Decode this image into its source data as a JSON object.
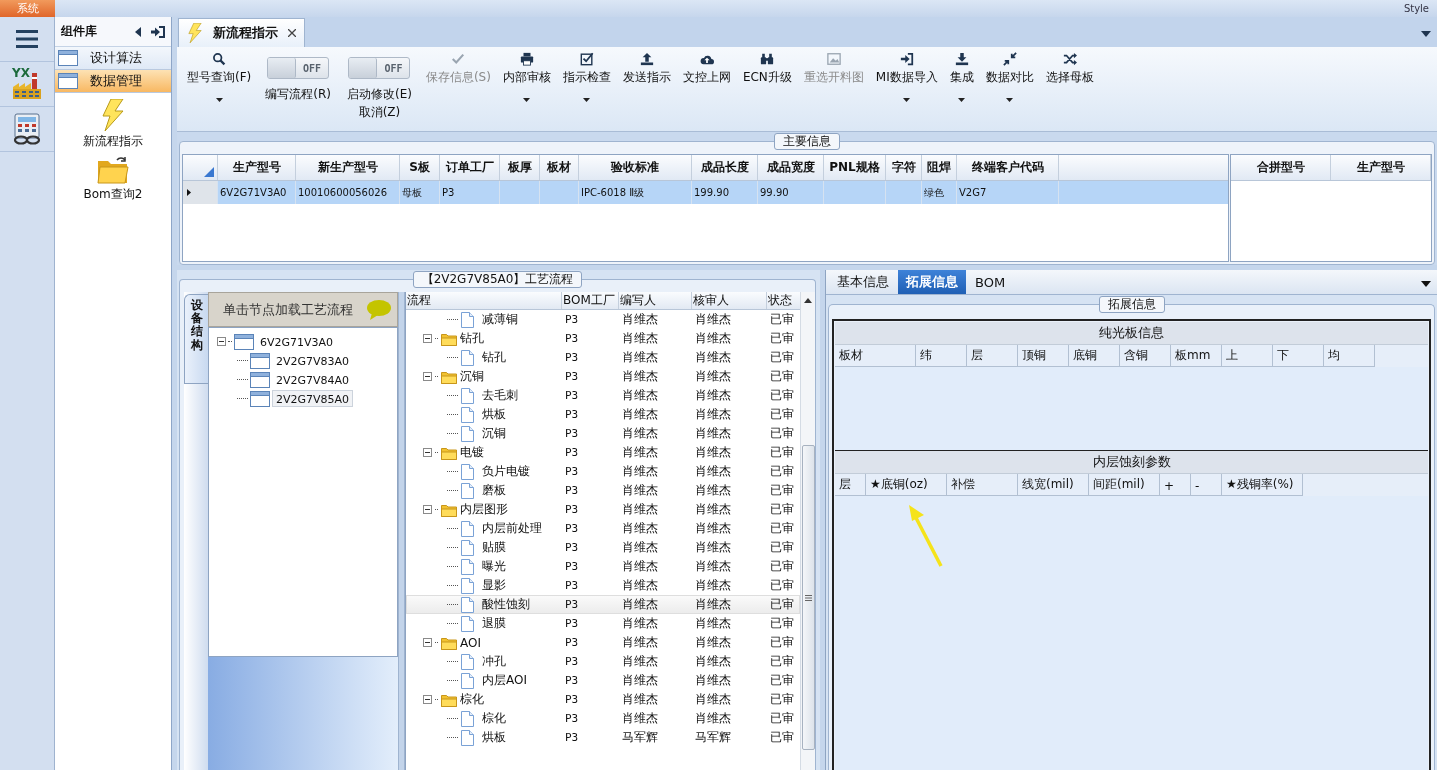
{
  "top_bar": {
    "system_button": "系统",
    "style_label": "Style"
  },
  "rail": {
    "app_badge": "YX"
  },
  "component_panel": {
    "title": "组件库",
    "groups": [
      {
        "label": "设计算法",
        "selected": false
      },
      {
        "label": "数据管理",
        "selected": true
      }
    ],
    "items": [
      {
        "label": "新流程指示"
      },
      {
        "label": "Bom查询2"
      }
    ]
  },
  "document_tab": {
    "label": "新流程指示"
  },
  "toolbar": [
    {
      "kind": "button",
      "label": "型号查询(F)",
      "dropdown": true,
      "disabled": false
    },
    {
      "kind": "toggle",
      "label": "编写流程(R)",
      "state_text": "OFF",
      "on": false
    },
    {
      "kind": "toggle",
      "label": "启动修改(E)\n取消(Z)",
      "state_text": "OFF",
      "on": false
    },
    {
      "kind": "button",
      "label": "保存信息(S)",
      "dropdown": false,
      "disabled": true
    },
    {
      "kind": "button",
      "label": "内部审核",
      "dropdown": true,
      "disabled": false
    },
    {
      "kind": "button",
      "label": "指示检查",
      "dropdown": true,
      "disabled": false
    },
    {
      "kind": "button",
      "label": "发送指示",
      "dropdown": false,
      "disabled": false
    },
    {
      "kind": "button",
      "label": "文控上网",
      "dropdown": false,
      "disabled": false
    },
    {
      "kind": "button",
      "label": "ECN升级",
      "dropdown": false,
      "disabled": false
    },
    {
      "kind": "button",
      "label": "重选开料图",
      "dropdown": false,
      "disabled": true
    },
    {
      "kind": "button",
      "label": "MI数据导入",
      "dropdown": true,
      "disabled": false
    },
    {
      "kind": "button",
      "label": "集成",
      "dropdown": true,
      "disabled": false
    },
    {
      "kind": "button",
      "label": "数据对比",
      "dropdown": true,
      "disabled": false
    },
    {
      "kind": "button",
      "label": "选择母板",
      "dropdown": false,
      "disabled": false
    }
  ],
  "main_info": {
    "title": "主要信息",
    "columns": [
      "生产型号",
      "新生产型号",
      "S板",
      "订单工厂",
      "板厚",
      "板材",
      "验收标准",
      "成品长度",
      "成品宽度",
      "PNL规格",
      "字符",
      "阻焊",
      "终端客户代码"
    ],
    "rows": [
      {
        "selected": true,
        "cells": [
          "6V2G71V3A0",
          "10010600056026",
          "母板",
          "P3",
          null,
          null,
          "IPC-6018 Ⅱ级",
          "199.90",
          "99.90",
          null,
          null,
          "绿色",
          "V2G7"
        ]
      }
    ],
    "side_columns": [
      "合拼型号",
      "生产型号"
    ]
  },
  "process_panel": {
    "title": "【2V2G7V85A0】工艺流程",
    "side_tab": "设备结构",
    "hint": "单击节点加载工艺流程",
    "tree": [
      {
        "label": "6V2G71V3A0",
        "expanded": true,
        "selected": false,
        "children": [
          {
            "label": "2V2G7V83A0",
            "selected": false
          },
          {
            "label": "2V2G7V84A0",
            "selected": false
          },
          {
            "label": "2V2G7V85A0",
            "selected": true
          }
        ]
      }
    ],
    "columns": [
      "流程",
      "BOM工厂",
      "编写人",
      "核审人",
      "状态"
    ],
    "rows": [
      {
        "kind": "continued",
        "children": [
          {
            "kind": "step",
            "label": "减薄铜",
            "factory": "P3",
            "writer": "肖维杰",
            "reviewer": "肖维杰",
            "status": "已审",
            "selected": false
          }
        ]
      },
      {
        "kind": "group",
        "label": "钻孔",
        "factory": "P3",
        "writer": "肖维杰",
        "reviewer": "肖维杰",
        "status": "已审",
        "selected": false,
        "expanded": true,
        "children": [
          {
            "kind": "step",
            "label": "钻孔",
            "factory": "P3",
            "writer": "肖维杰",
            "reviewer": "肖维杰",
            "status": "已审",
            "selected": false
          }
        ]
      },
      {
        "kind": "group",
        "label": "沉铜",
        "factory": "P3",
        "writer": "肖维杰",
        "reviewer": "肖维杰",
        "status": "已审",
        "selected": false,
        "expanded": true,
        "children": [
          {
            "kind": "step",
            "label": "去毛刺",
            "factory": "P3",
            "writer": "肖维杰",
            "reviewer": "肖维杰",
            "status": "已审",
            "selected": false
          },
          {
            "kind": "step",
            "label": "烘板",
            "factory": "P3",
            "writer": "肖维杰",
            "reviewer": "肖维杰",
            "status": "已审",
            "selected": false
          },
          {
            "kind": "step",
            "label": "沉铜",
            "factory": "P3",
            "writer": "肖维杰",
            "reviewer": "肖维杰",
            "status": "已审",
            "selected": false
          }
        ]
      },
      {
        "kind": "group",
        "label": "电镀",
        "factory": "P3",
        "writer": "肖维杰",
        "reviewer": "肖维杰",
        "status": "已审",
        "selected": false,
        "expanded": true,
        "children": [
          {
            "kind": "step",
            "label": "负片电镀",
            "factory": "P3",
            "writer": "肖维杰",
            "reviewer": "肖维杰",
            "status": "已审",
            "selected": false
          },
          {
            "kind": "step",
            "label": "磨板",
            "factory": "P3",
            "writer": "肖维杰",
            "reviewer": "肖维杰",
            "status": "已审",
            "selected": false
          }
        ]
      },
      {
        "kind": "group",
        "label": "内层图形",
        "factory": "P3",
        "writer": "肖维杰",
        "reviewer": "肖维杰",
        "status": "已审",
        "selected": false,
        "expanded": true,
        "children": [
          {
            "kind": "step",
            "label": "内层前处理",
            "factory": "P3",
            "writer": "肖维杰",
            "reviewer": "肖维杰",
            "status": "已审",
            "selected": false
          },
          {
            "kind": "step",
            "label": "贴膜",
            "factory": "P3",
            "writer": "肖维杰",
            "reviewer": "肖维杰",
            "status": "已审",
            "selected": false
          },
          {
            "kind": "step",
            "label": "曝光",
            "factory": "P3",
            "writer": "肖维杰",
            "reviewer": "肖维杰",
            "status": "已审",
            "selected": false
          },
          {
            "kind": "step",
            "label": "显影",
            "factory": "P3",
            "writer": "肖维杰",
            "reviewer": "肖维杰",
            "status": "已审",
            "selected": false
          },
          {
            "kind": "step",
            "label": "酸性蚀刻",
            "factory": "P3",
            "writer": "肖维杰",
            "reviewer": "肖维杰",
            "status": "已审",
            "selected": true
          },
          {
            "kind": "step",
            "label": "退膜",
            "factory": "P3",
            "writer": "肖维杰",
            "reviewer": "肖维杰",
            "status": "已审",
            "selected": false
          }
        ]
      },
      {
        "kind": "group",
        "label": "AOI",
        "factory": "P3",
        "writer": "肖维杰",
        "reviewer": "肖维杰",
        "status": "已审",
        "selected": false,
        "expanded": true,
        "children": [
          {
            "kind": "step",
            "label": "冲孔",
            "factory": "P3",
            "writer": "肖维杰",
            "reviewer": "肖维杰",
            "status": "已审",
            "selected": false
          },
          {
            "kind": "step",
            "label": "内层AOI",
            "factory": "P3",
            "writer": "肖维杰",
            "reviewer": "肖维杰",
            "status": "已审",
            "selected": false
          }
        ]
      },
      {
        "kind": "group",
        "label": "棕化",
        "factory": "P3",
        "writer": "肖维杰",
        "reviewer": "肖维杰",
        "status": "已审",
        "selected": false,
        "expanded": true,
        "children": [
          {
            "kind": "step",
            "label": "棕化",
            "factory": "P3",
            "writer": "肖维杰",
            "reviewer": "肖维杰",
            "status": "已审",
            "selected": false
          },
          {
            "kind": "step",
            "label": "烘板",
            "factory": "P3",
            "writer": "马军辉",
            "reviewer": "马军辉",
            "status": "已审",
            "selected": false
          }
        ]
      }
    ]
  },
  "detail_panel": {
    "tabs": [
      {
        "label": "基本信息",
        "selected": false
      },
      {
        "label": "拓展信息",
        "selected": true
      },
      {
        "label": "BOM",
        "selected": false
      }
    ],
    "group_title": "拓展信息",
    "sections": [
      {
        "title": "纯光板信息",
        "columns": [
          "板材",
          "纬",
          "层",
          "顶铜",
          "底铜",
          "含铜",
          "板mm",
          "上",
          "下",
          "均"
        ]
      },
      {
        "title": "内层蚀刻参数",
        "columns": [
          "层",
          "★底铜(oz)",
          "补偿",
          "线宽(mil)",
          "间距(mil)",
          "+",
          "-",
          "★残铜率(%)"
        ]
      }
    ]
  }
}
